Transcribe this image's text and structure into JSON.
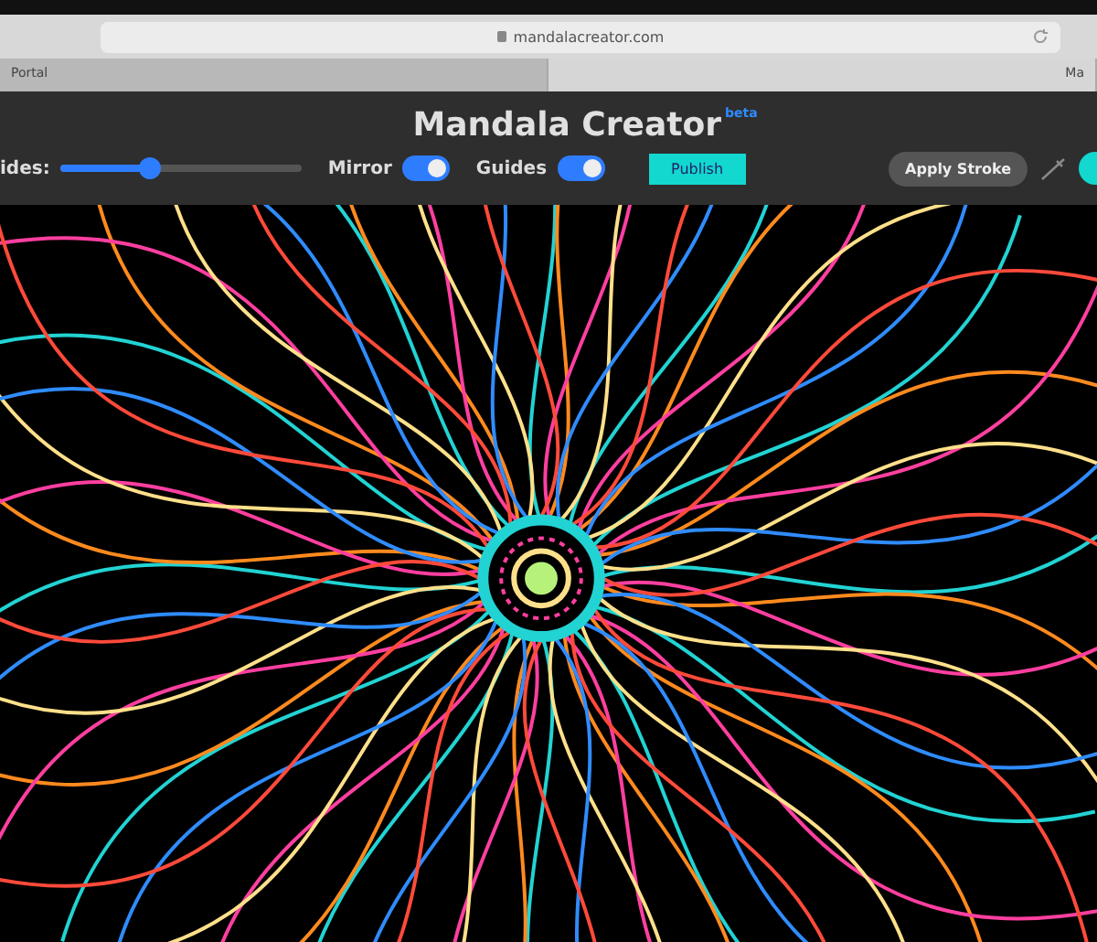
{
  "browser": {
    "url": "mandalacreator.com",
    "tabs": [
      {
        "label": "Portal",
        "selected": false
      },
      {
        "label": "Ma",
        "selected": true
      }
    ]
  },
  "app": {
    "title": "Mandala Creator",
    "badge": "beta"
  },
  "toolbar": {
    "sides": {
      "label": "ides:",
      "level": 0.37
    },
    "toggles": [
      {
        "label": "Mirror",
        "on": true
      },
      {
        "label": "Guides",
        "on": true
      }
    ],
    "publish": "Publish",
    "apply": "Apply Stroke"
  }
}
